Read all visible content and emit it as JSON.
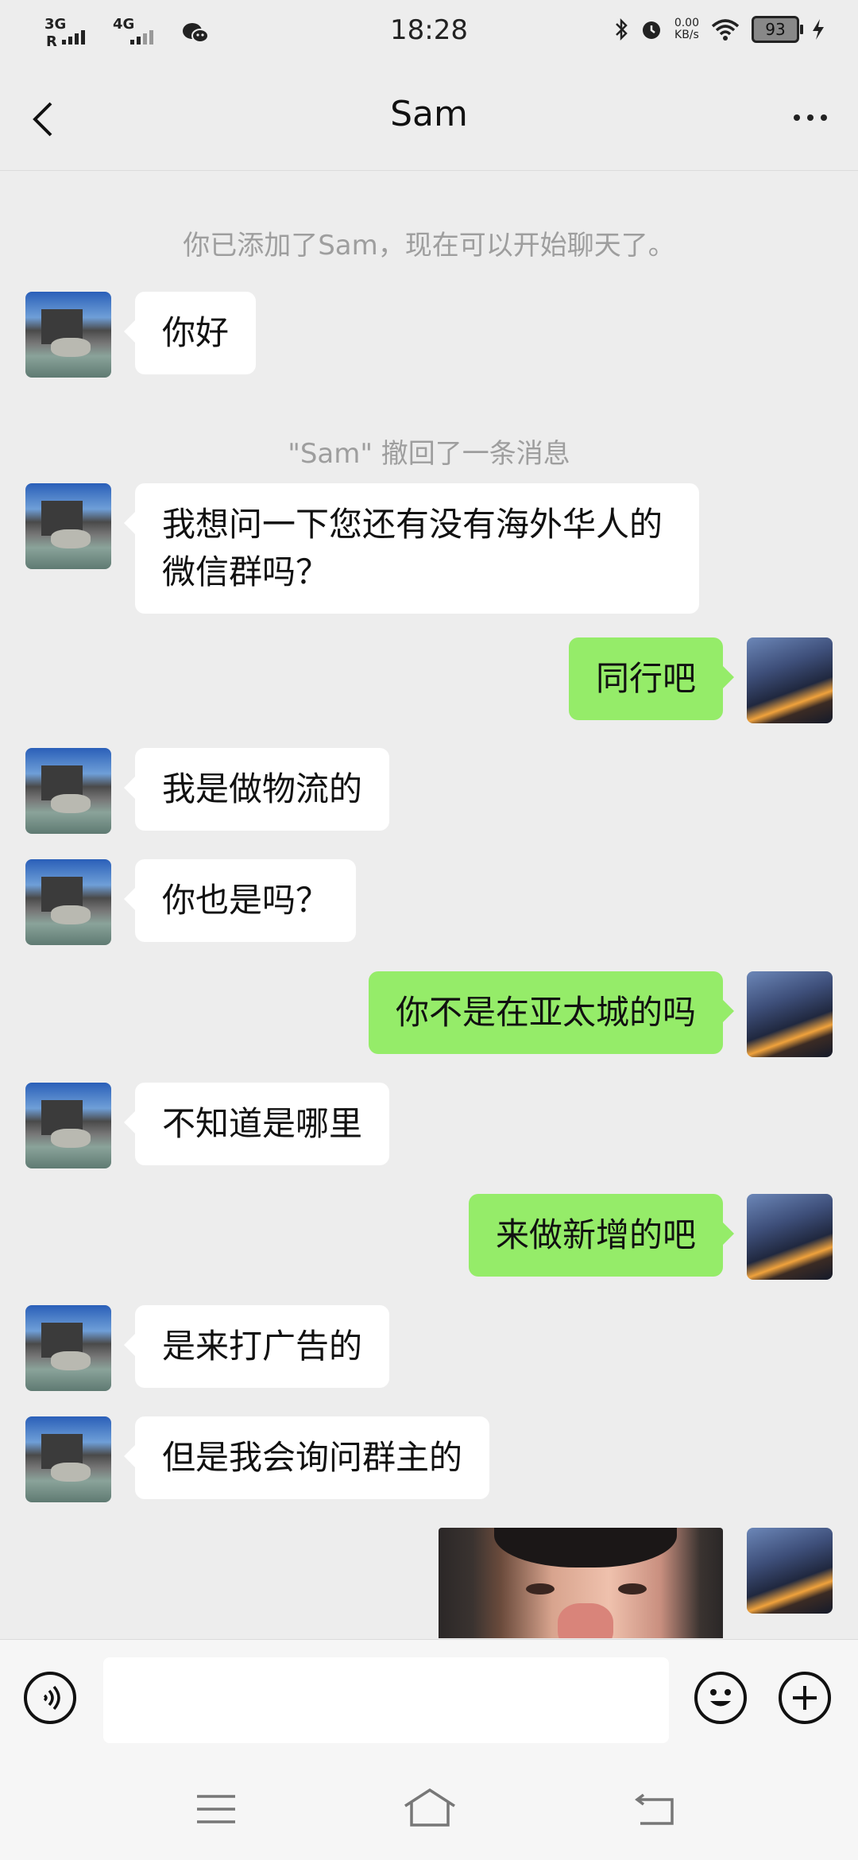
{
  "status_bar": {
    "time": "18:28",
    "sim1": "3G",
    "sim1_roaming": "R",
    "sim2": "4G",
    "net_speed_value": "0.00",
    "net_speed_unit": "KB/s",
    "battery": "93",
    "icons": [
      "wechat-icon",
      "bluetooth-icon",
      "alarm-icon",
      "wifi-icon",
      "battery-icon",
      "charging-icon"
    ]
  },
  "header": {
    "title": "Sam",
    "icons": [
      "back-arrow-icon",
      "more-icon"
    ]
  },
  "messages": [
    {
      "type": "system",
      "text": "你已添加了Sam，现在可以开始聊天了。"
    },
    {
      "type": "in",
      "text": "你好"
    },
    {
      "type": "system",
      "text": "\"Sam\" 撤回了一条消息"
    },
    {
      "type": "in",
      "text": "我想问一下您还有没有海外华人的微信群吗？"
    },
    {
      "type": "out",
      "text": "同行吧"
    },
    {
      "type": "in",
      "text": "我是做物流的"
    },
    {
      "type": "in",
      "text": "你也是吗？"
    },
    {
      "type": "out",
      "text": "你不是在亚太城的吗"
    },
    {
      "type": "in",
      "text": "不知道是哪里"
    },
    {
      "type": "out",
      "text": "来做新增的吧"
    },
    {
      "type": "in",
      "text": "是来打广告的"
    },
    {
      "type": "in",
      "text": "但是我会询问群主的"
    },
    {
      "type": "out_sticker",
      "text": ""
    }
  ],
  "input_bar": {
    "value": "",
    "icons": [
      "voice-icon",
      "emoji-icon",
      "plus-icon"
    ]
  },
  "nav_bar": {
    "icons": [
      "menu-icon",
      "home-icon",
      "back-icon"
    ]
  }
}
